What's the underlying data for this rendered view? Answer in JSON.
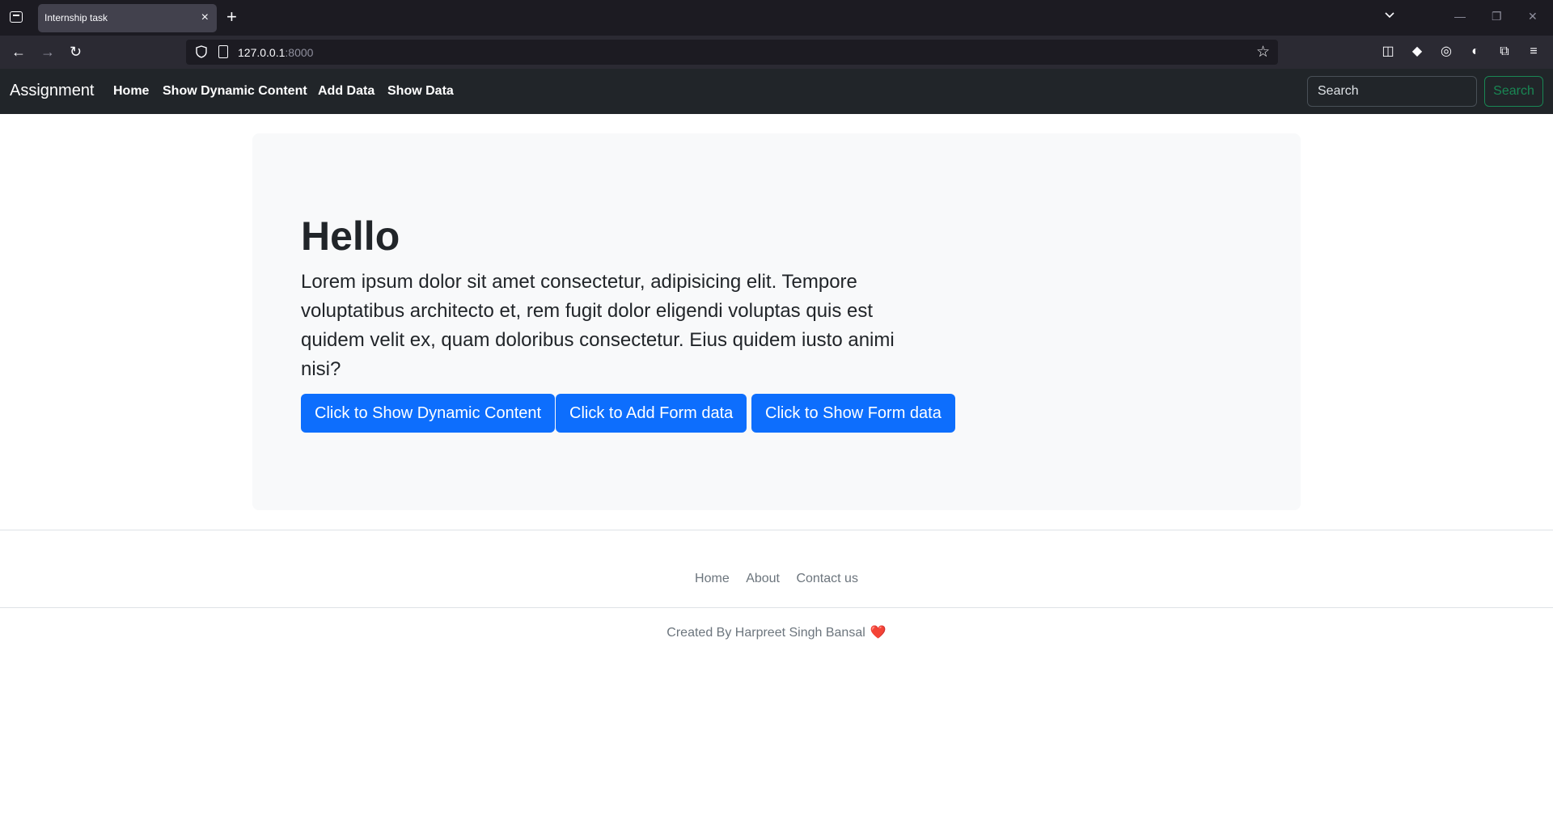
{
  "browser": {
    "tab_title": "Internship task",
    "tab_close": "×",
    "new_tab": "+",
    "url_host": "127.0.0.1",
    "url_port": ":8000"
  },
  "navbar": {
    "brand": "Assignment",
    "links": [
      "Home",
      "Show Dynamic Content",
      "Add Data",
      "Show Data"
    ],
    "search_placeholder": "Search",
    "search_button": "Search"
  },
  "hero": {
    "title": "Hello",
    "lead": "Lorem ipsum dolor sit amet consectetur, adipisicing elit. Tempore voluptatibus architecto et, rem fugit dolor eligendi voluptas quis est quidem velit ex, quam doloribus consectetur. Eius quidem iusto animi nisi?",
    "buttons": [
      "Click to Show Dynamic Content",
      "Click to Add Form data",
      "Click to Show Form data"
    ]
  },
  "footer": {
    "links": [
      "Home",
      "About",
      "Contact us"
    ],
    "credit": "Created By Harpreet Singh Bansal",
    "heart": "❤️"
  },
  "colors": {
    "primary": "#0d6efd",
    "success": "#198754",
    "navbar_bg": "#212529"
  }
}
